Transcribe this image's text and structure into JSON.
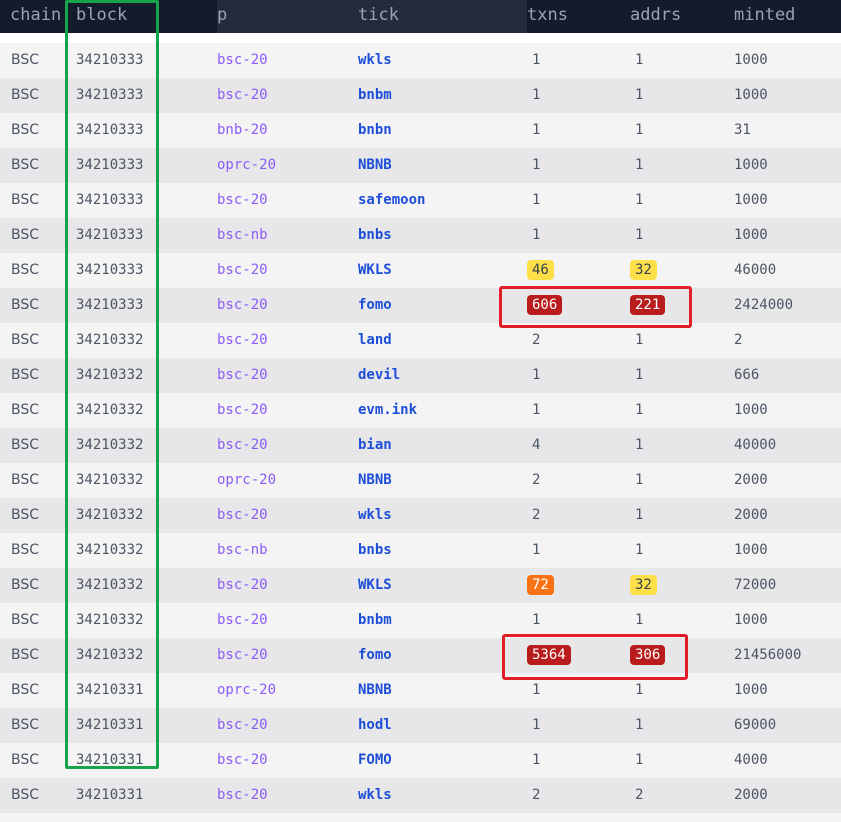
{
  "headers": [
    "chain",
    "block",
    "p",
    "tick",
    "txns",
    "addrs",
    "minted"
  ],
  "rows": [
    {
      "chain": "BSC",
      "block": "34210333",
      "p": "bsc-20",
      "tick": "wkls",
      "txns": "1",
      "addrs": "1",
      "minted": "1000"
    },
    {
      "chain": "BSC",
      "block": "34210333",
      "p": "bsc-20",
      "tick": "bnbm",
      "txns": "1",
      "addrs": "1",
      "minted": "1000"
    },
    {
      "chain": "BSC",
      "block": "34210333",
      "p": "bnb-20",
      "tick": "bnbn",
      "txns": "1",
      "addrs": "1",
      "minted": "31"
    },
    {
      "chain": "BSC",
      "block": "34210333",
      "p": "oprc-20",
      "tick": "NBNB",
      "txns": "1",
      "addrs": "1",
      "minted": "1000"
    },
    {
      "chain": "BSC",
      "block": "34210333",
      "p": "bsc-20",
      "tick": "safemoon",
      "txns": "1",
      "addrs": "1",
      "minted": "1000"
    },
    {
      "chain": "BSC",
      "block": "34210333",
      "p": "bsc-nb",
      "tick": "bnbs",
      "txns": "1",
      "addrs": "1",
      "minted": "1000"
    },
    {
      "chain": "BSC",
      "block": "34210333",
      "p": "bsc-20",
      "tick": "WKLS",
      "txns": "46",
      "txns_badge": "yellow",
      "addrs": "32",
      "addrs_badge": "yellow",
      "minted": "46000"
    },
    {
      "chain": "BSC",
      "block": "34210333",
      "p": "bsc-20",
      "tick": "fomo",
      "txns": "606",
      "txns_badge": "red",
      "addrs": "221",
      "addrs_badge": "red",
      "minted": "2424000"
    },
    {
      "chain": "BSC",
      "block": "34210332",
      "p": "bsc-20",
      "tick": "land",
      "txns": "2",
      "addrs": "1",
      "minted": "2"
    },
    {
      "chain": "BSC",
      "block": "34210332",
      "p": "bsc-20",
      "tick": "devil",
      "txns": "1",
      "addrs": "1",
      "minted": "666"
    },
    {
      "chain": "BSC",
      "block": "34210332",
      "p": "bsc-20",
      "tick": "evm.ink",
      "txns": "1",
      "addrs": "1",
      "minted": "1000"
    },
    {
      "chain": "BSC",
      "block": "34210332",
      "p": "bsc-20",
      "tick": "bian",
      "txns": "4",
      "addrs": "1",
      "minted": "40000"
    },
    {
      "chain": "BSC",
      "block": "34210332",
      "p": "oprc-20",
      "tick": "NBNB",
      "txns": "2",
      "addrs": "1",
      "minted": "2000"
    },
    {
      "chain": "BSC",
      "block": "34210332",
      "p": "bsc-20",
      "tick": "wkls",
      "txns": "2",
      "addrs": "1",
      "minted": "2000"
    },
    {
      "chain": "BSC",
      "block": "34210332",
      "p": "bsc-nb",
      "tick": "bnbs",
      "txns": "1",
      "addrs": "1",
      "minted": "1000"
    },
    {
      "chain": "BSC",
      "block": "34210332",
      "p": "bsc-20",
      "tick": "WKLS",
      "txns": "72",
      "txns_badge": "orange",
      "addrs": "32",
      "addrs_badge": "yellow",
      "minted": "72000"
    },
    {
      "chain": "BSC",
      "block": "34210332",
      "p": "bsc-20",
      "tick": "bnbm",
      "txns": "1",
      "addrs": "1",
      "minted": "1000"
    },
    {
      "chain": "BSC",
      "block": "34210332",
      "p": "bsc-20",
      "tick": "fomo",
      "txns": "5364",
      "txns_badge": "red",
      "addrs": "306",
      "addrs_badge": "red",
      "minted": "21456000"
    },
    {
      "chain": "BSC",
      "block": "34210331",
      "p": "oprc-20",
      "tick": "NBNB",
      "txns": "1",
      "addrs": "1",
      "minted": "1000"
    },
    {
      "chain": "BSC",
      "block": "34210331",
      "p": "bsc-20",
      "tick": "hodl",
      "txns": "1",
      "addrs": "1",
      "minted": "69000"
    },
    {
      "chain": "BSC",
      "block": "34210331",
      "p": "bsc-20",
      "tick": "FOMO",
      "txns": "1",
      "addrs": "1",
      "minted": "4000"
    },
    {
      "chain": "BSC",
      "block": "34210331",
      "p": "bsc-20",
      "tick": "wkls",
      "txns": "2",
      "addrs": "2",
      "minted": "2000"
    }
  ],
  "colors": {
    "header_bg": "#141b2d",
    "protocol": "#8b5cf6",
    "tick": "#1d4ed8",
    "highlight_block_column": "#16a34a",
    "highlight_hot_rows": "#e11d28"
  }
}
